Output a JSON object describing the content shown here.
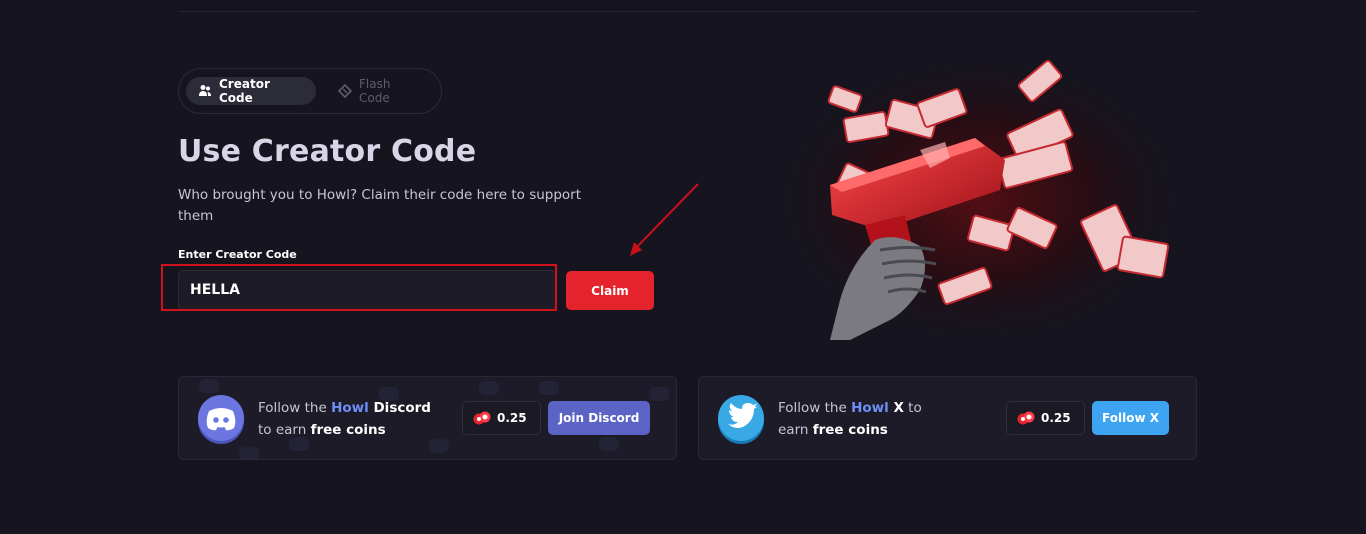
{
  "tabs": [
    {
      "label": "Creator Code",
      "icon": "user-group-icon",
      "active": true
    },
    {
      "label": "Flash Code",
      "icon": "ticket-icon",
      "active": false
    }
  ],
  "page": {
    "title": "Use Creator Code",
    "subtitle": "Who brought you to Howl? Claim their code here to support them"
  },
  "form": {
    "label": "Enter Creator Code",
    "value": "HELLA",
    "claim_label": "Claim"
  },
  "discord_card": {
    "line1_prefix": "Follow the ",
    "brand": "Howl",
    "line1_suffix": " Discord",
    "line2_prefix": "to earn ",
    "line2_bold": "free coins",
    "reward": "0.25",
    "button_label": "Join Discord"
  },
  "twitter_card": {
    "line1_prefix": "Follow the ",
    "brand": "Howl",
    "line1_suffix": " X",
    "line1_after": " to",
    "line2_prefix": "earn ",
    "line2_bold": "free coins",
    "reward": "0.25",
    "button_label": "Follow X"
  },
  "colors": {
    "accent_red": "#e4232c",
    "discord": "#5b63c4",
    "twitter": "#3ea3f0",
    "brand_blue": "#6f8ff8"
  }
}
